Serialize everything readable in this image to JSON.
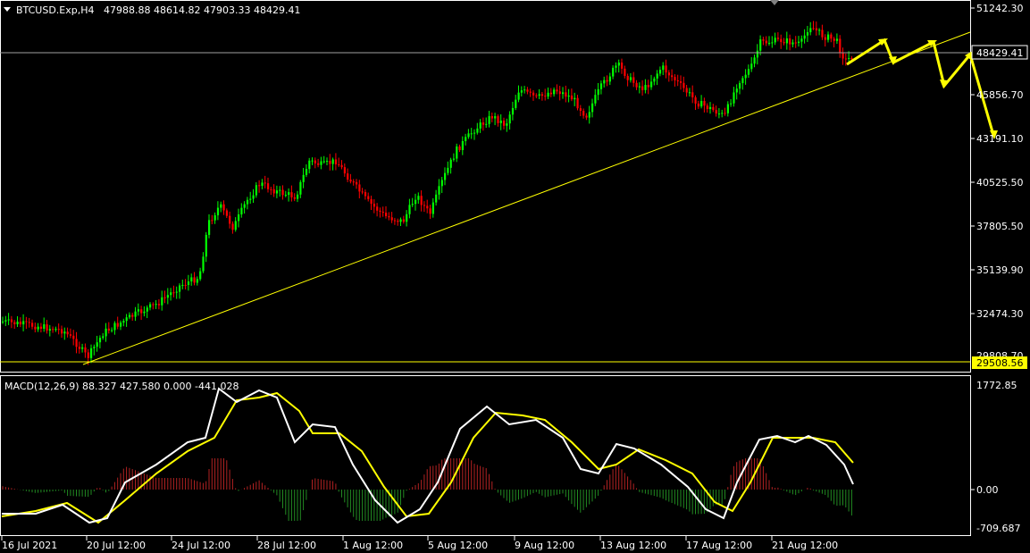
{
  "header": {
    "symbol_label": "BTCUSD.Exp,H4",
    "ohlc": "47988.88 48614.82 47903.33 48429.41",
    "dropdown_icon": "triangle-down-icon"
  },
  "price_axis": {
    "ticks": [
      "51242.30",
      "48429.41",
      "45856.70",
      "43191.10",
      "40525.50",
      "37805.50",
      "35139.90",
      "32474.30",
      "29808.70"
    ],
    "current_price_label": "48429.41",
    "support_price_label": "29508.56"
  },
  "macd": {
    "label": "MACD(12,26,9) 88.327 427.580 0.000 -441.028",
    "axis_ticks": [
      "1772.85",
      "0.00",
      "-709.687"
    ],
    "colors": {
      "macd_line": "#ffffff",
      "signal_line": "#ffff00",
      "hist_positive": "#b22222",
      "hist_negative": "#228b22"
    }
  },
  "time_axis": {
    "ticks": [
      "16 Jul 2021",
      "20 Jul 12:00",
      "24 Jul 12:00",
      "28 Jul 12:00",
      "1 Aug 12:00",
      "5 Aug 12:00",
      "9 Aug 12:00",
      "13 Aug 12:00",
      "17 Aug 12:00",
      "21 Aug 12:00"
    ]
  },
  "colors": {
    "background": "#000000",
    "bull_candle": "#00ff00",
    "bear_candle": "#ff0000",
    "trendline": "#ffff00",
    "arrows": "#ffff00",
    "grid_border": "#ffffff",
    "price_line": "#a0a0a0"
  }
}
